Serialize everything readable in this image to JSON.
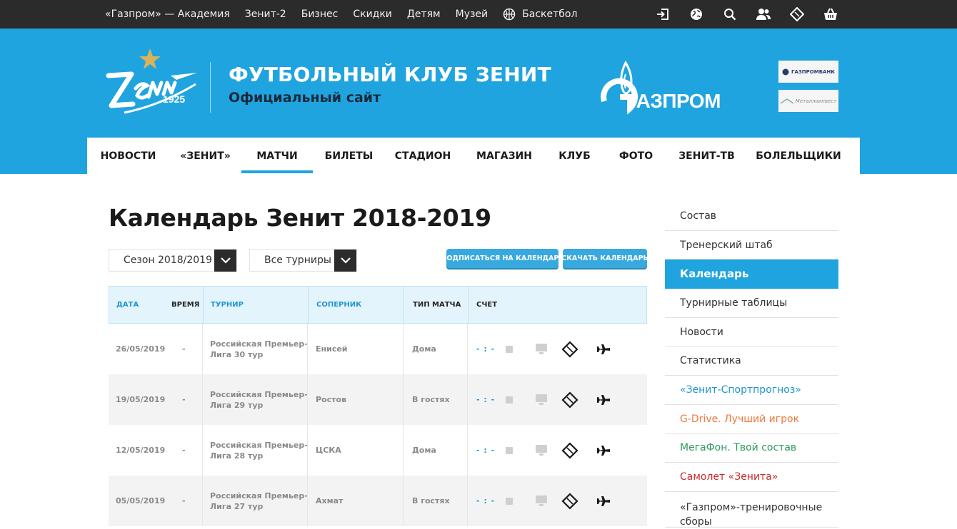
{
  "colors": {
    "brand_blue": "#20a4e0",
    "dark": "#2b2b2b",
    "link_blue": "#1e96d2",
    "orange": "#f07a3c",
    "green": "#2f9a5e",
    "red": "#cc2b2b"
  },
  "topnav": {
    "items": [
      "«Газпром» — Академия",
      "Зенит-2",
      "Бизнес",
      "Скидки",
      "Детям",
      "Музей"
    ],
    "basketball": "Баскетбол",
    "icons": [
      "login-icon",
      "globe-icon",
      "search-icon",
      "users-icon",
      "ticket-icon",
      "shop-basket-icon"
    ]
  },
  "header": {
    "logo_year": "1925",
    "title": "ФУТБОЛЬНЫЙ КЛУБ ЗЕНИТ",
    "subtitle": "Официальный сайт",
    "sponsor_main": "ГАЗПРОМ",
    "sponsor1": "ГАЗПРОМБАНК",
    "sponsor2": "Металлоинвест"
  },
  "mainnav": [
    "НОВОСТИ",
    "«ЗЕНИТ»",
    "МАТЧИ",
    "БИЛЕТЫ",
    "СТАДИОН",
    "МАГАЗИН",
    "КЛУБ",
    "ФОТО",
    "ЗЕНИТ-ТВ",
    "БОЛЕЛЬЩИКИ"
  ],
  "page": {
    "title": "Календарь Зенит 2018-2019",
    "season_select": "Сезон 2018/2019",
    "tournament_select": "Все турниры",
    "subscribe_btn": "ПОДПИСАТЬСЯ НА КАЛЕНДАРЬ",
    "download_btn": "СКАЧАТЬ КАЛЕНДАРЬ"
  },
  "table": {
    "headers": {
      "date": "ДАТА",
      "time": "ВРЕМЯ",
      "tournament": "ТУРНИР",
      "opponent": "СОПЕРНИК",
      "type": "ТИП МАТЧА",
      "score": "СЧЕТ"
    },
    "rows": [
      {
        "date": "26/05/2019",
        "time": "-",
        "tour1": "Российская Премьер-",
        "tour2": "Лига 30 тур",
        "opponent": "Енисей",
        "type": "Дома",
        "score": "- : -"
      },
      {
        "date": "19/05/2019",
        "time": "-",
        "tour1": "Российская Премьер-",
        "tour2": "Лига 29 тур",
        "opponent": "Ростов",
        "type": "В гостях",
        "score": "- : -"
      },
      {
        "date": "12/05/2019",
        "time": "-",
        "tour1": "Российская Премьер-",
        "tour2": "Лига 28 тур",
        "opponent": "ЦСКА",
        "type": "Дома",
        "score": "- : -"
      },
      {
        "date": "05/05/2019",
        "time": "-",
        "tour1": "Российская Премьер-",
        "tour2": "Лига 27 тур",
        "opponent": "Ахмат",
        "type": "В гостях",
        "score": "- : -"
      }
    ]
  },
  "sidebar": [
    {
      "label": "Состав"
    },
    {
      "label": "Тренерский штаб"
    },
    {
      "label": "Календарь"
    },
    {
      "label": "Турнирные таблицы"
    },
    {
      "label": "Новости"
    },
    {
      "label": "Статистика"
    },
    {
      "label": "«Зенит-Спортпрогноз»"
    },
    {
      "label": "G-Drive. Лучший игрок"
    },
    {
      "label": "МегаФон. Твой состав"
    },
    {
      "label": "Самолет «Зенита»"
    },
    {
      "label": "«Газпром»-тренировочные сборы"
    }
  ]
}
